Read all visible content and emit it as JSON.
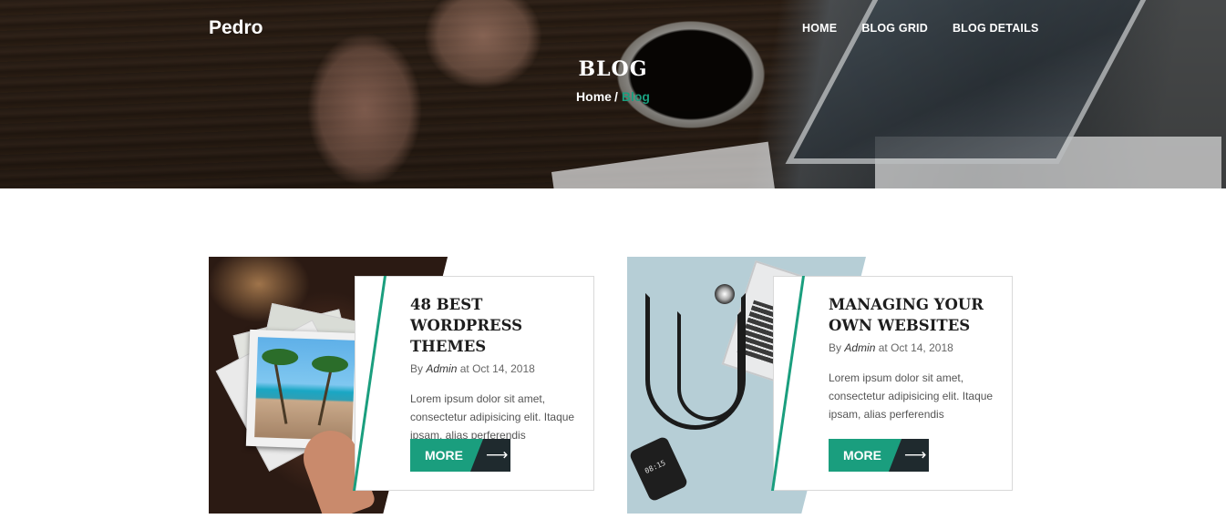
{
  "header": {
    "brand": "Pedro",
    "nav": [
      {
        "label": "HOME"
      },
      {
        "label": "BLOG GRID"
      },
      {
        "label": "BLOG DETAILS"
      }
    ]
  },
  "hero": {
    "title": "BLOG",
    "breadcrumb": {
      "home": "Home",
      "separator": "/",
      "current": "Blog"
    }
  },
  "posts": [
    {
      "title": "48 BEST WORDPRESS THEMES",
      "meta_prefix": "By",
      "author": "Admin",
      "meta_mid": "at",
      "date": "Oct 14, 2018",
      "excerpt": "Lorem ipsum dolor sit amet, consectetur adipisicing elit. Itaque ipsam, alias perferendis",
      "button_label": "MORE",
      "image": "beach-photo-stack"
    },
    {
      "title": "MANAGING YOUR OWN WEBSITES",
      "meta_prefix": "By",
      "author": "Admin",
      "meta_mid": "at",
      "date": "Oct 14, 2018",
      "excerpt": "Lorem ipsum dolor sit amet, consectetur adipisicing elit. Itaque ipsam, alias perferendis",
      "button_label": "MORE",
      "image": "stethoscope-laptop-desk",
      "phone_clock": "08:15"
    }
  ],
  "icons": {
    "more_arrow": "arrow-right-icon"
  },
  "colors": {
    "accent": "#1a9e7e",
    "dark_button": "#1f2a2e",
    "text_dark": "#1d1d1d"
  }
}
